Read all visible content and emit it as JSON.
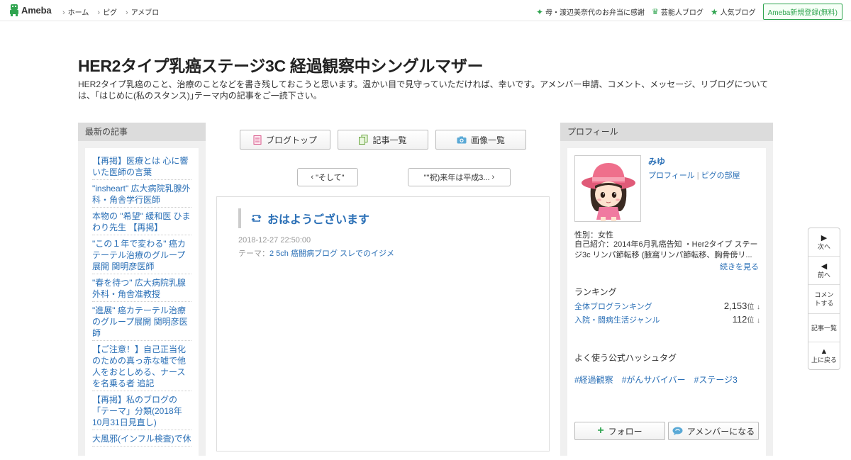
{
  "topbar": {
    "logo_text": "Ameba",
    "nav": [
      "ホーム",
      "ピグ",
      "アメブロ"
    ],
    "right_items": [
      {
        "icon": "sparkle-icon",
        "label": "母・渡辺美奈代のお弁当に感謝"
      },
      {
        "icon": "crown-icon",
        "label": "芸能人ブログ"
      },
      {
        "icon": "star-icon",
        "label": "人気ブログ"
      }
    ],
    "register_label": "Ameba新規登録(無料)"
  },
  "blog": {
    "title": "HER2タイプ乳癌ステージ3C 経過観察中シングルマザー",
    "description": "HER2タイプ乳癌のこと、治療のことなどを書き残しておこうと思います。温かい目で見守っていただければ、幸いです。アメンバー申請、コメント、メッセージ、リブログについては、｢はじめに(私のスタンス)｣テーマ内の記事をご一読下さい。"
  },
  "left": {
    "heading": "最新の記事",
    "items": [
      "【再掲】医療とは 心に響いた医師の言葉",
      "\"insheart\" 広大病院乳腺外科・角舎学行医師",
      "本物の \"希望\" 緩和医 ひまわり先生 【再掲】",
      "\"この１年で変わる\" 癌カテーテル治療のグループ展開 関明彦医師",
      "\"春を待つ\" 広大病院乳腺外科・角舎准教授",
      "\"進展\" 癌カテーテル治療のグループ展開 関明彦医師",
      "【ご注意！】自己正当化のための真っ赤な嘘で他人をおとしめる、ナースを名乗る者 追記",
      "【再掲】私のブログの「テーマ」分類(2018年10月31日見直し)",
      "大風邪(インフル検査)で休"
    ]
  },
  "center": {
    "buttons": [
      {
        "icon": "blog-top-icon",
        "label": "ブログトップ"
      },
      {
        "icon": "article-list-icon",
        "label": "記事一覧"
      },
      {
        "icon": "camera-icon",
        "label": "画像一覧"
      }
    ],
    "prev_label": "\"そして\"",
    "next_label": "\"\"祝)来年は平成3...",
    "entry": {
      "title": "おはようございます",
      "date": "2018-12-27 22:50:00",
      "theme_prefix": "テーマ：",
      "theme": "2 5ch 癌闘病ブログ スレでのイジメ"
    }
  },
  "profile": {
    "heading": "プロフィール",
    "name": "みゆ",
    "link_profile": "プロフィール",
    "link_room": "ピグの部屋",
    "gender": "性別：女性",
    "intro": "自己紹介：2014年6月乳癌告知 ・Her2タイプ ステージ3c リンパ節転移 (腋窩リンパ節転移、胸骨傍リ...",
    "more": "続きを見る",
    "ranking_heading": "ランキング",
    "rankings": [
      {
        "label": "全体ブログランキング",
        "value": "2,153",
        "unit": "位",
        "trend": "↓"
      },
      {
        "label": "入院・闘病生活ジャンル",
        "value": "112",
        "unit": "位",
        "trend": "↓"
      }
    ],
    "hashtag_heading": "よく使う公式ハッシュタグ",
    "hashtags": [
      "#経過観察",
      "#がんサバイバー",
      "#ステージ3"
    ],
    "follow_label": "フォロー",
    "amember_label": "アメンバーになる"
  },
  "sidenav": {
    "next": "次へ",
    "prev": "前へ",
    "comment": "コメントする",
    "list": "記事一覧",
    "top": "上に戻る"
  },
  "colors": {
    "link": "#2a6fb6",
    "brand_green": "#2fa44f",
    "column_bg": "#f0f0f0",
    "column_head": "#dcdcdc"
  }
}
